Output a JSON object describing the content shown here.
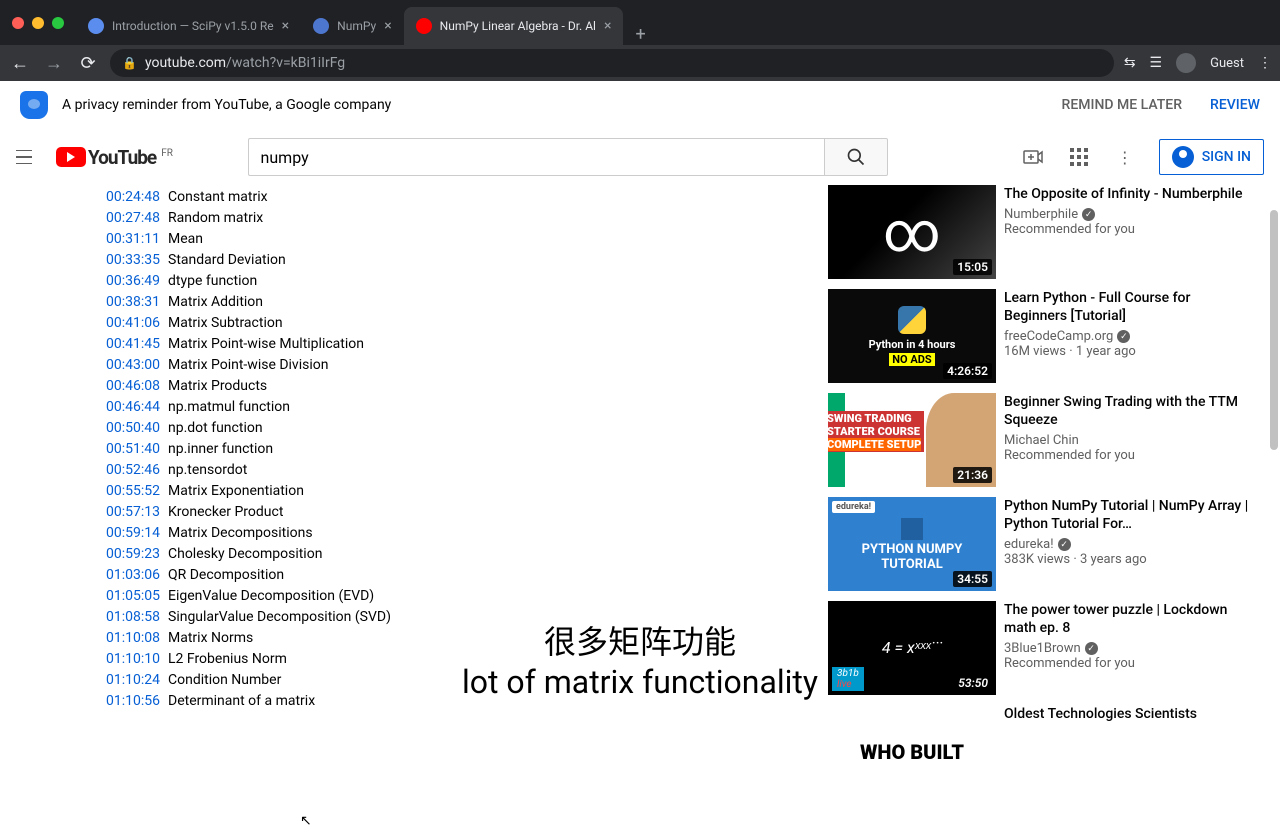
{
  "browser": {
    "tabs": [
      {
        "title": "Introduction — SciPy v1.5.0 Re"
      },
      {
        "title": "NumPy"
      },
      {
        "title": "NumPy Linear Algebra - Dr. Al"
      }
    ],
    "url_domain": "youtube.com",
    "url_path": "/watch?v=kBi1iIrFg",
    "guest_label": "Guest"
  },
  "privacy": {
    "text": "A privacy reminder from YouTube, a Google company",
    "remind": "REMIND ME LATER",
    "review": "REVIEW"
  },
  "yt_header": {
    "logo_text": "YouTube",
    "region": "FR",
    "search_value": "numpy",
    "signin": "SIGN IN"
  },
  "chapters": [
    {
      "time": "00:24:48",
      "label": "Constant matrix"
    },
    {
      "time": "00:27:48",
      "label": "Random matrix"
    },
    {
      "time": "00:31:11",
      "label": "Mean"
    },
    {
      "time": "00:33:35",
      "label": "Standard Deviation"
    },
    {
      "time": "00:36:49",
      "label": "dtype function"
    },
    {
      "time": "00:38:31",
      "label": "Matrix Addition"
    },
    {
      "time": "00:41:06",
      "label": "Matrix Subtraction"
    },
    {
      "time": "00:41:45",
      "label": "Matrix Point-wise Multiplication"
    },
    {
      "time": "00:43:00",
      "label": "Matrix Point-wise Division"
    },
    {
      "time": "00:46:08",
      "label": "Matrix Products"
    },
    {
      "time": "00:46:44",
      "label": "np.matmul function"
    },
    {
      "time": "00:50:40",
      "label": "np.dot function"
    },
    {
      "time": "00:51:40",
      "label": "np.inner function"
    },
    {
      "time": "00:52:46",
      "label": "np.tensordot"
    },
    {
      "time": "00:55:52",
      "label": "Matrix Exponentiation"
    },
    {
      "time": "00:57:13",
      "label": "Kronecker Product"
    },
    {
      "time": "00:59:14",
      "label": "Matrix Decompositions"
    },
    {
      "time": "00:59:23",
      "label": "Cholesky Decomposition"
    },
    {
      "time": "01:03:06",
      "label": "QR Decomposition"
    },
    {
      "time": "01:05:05",
      "label": "EigenValue Decomposition (EVD)"
    },
    {
      "time": "01:08:58",
      "label": "SingularValue Decomposition (SVD)"
    },
    {
      "time": "01:10:08",
      "label": "Matrix Norms"
    },
    {
      "time": "01:10:10",
      "label": "L2 Frobenius Norm"
    },
    {
      "time": "01:10:24",
      "label": "Condition Number"
    },
    {
      "time": "01:10:56",
      "label": "Determinant of a matrix"
    }
  ],
  "recommendations": [
    {
      "title": "The Opposite of Infinity - Numberphile",
      "channel": "Numberphile",
      "verified": true,
      "stats": "Recommended for you",
      "duration": "15:05"
    },
    {
      "title": "Learn Python - Full Course for Beginners [Tutorial]",
      "channel": "freeCodeCamp.org",
      "verified": true,
      "stats": "16M views · 1 year ago",
      "duration": "4:26:52",
      "thumb_text1": "Python in 4 hours",
      "thumb_text2": "NO ADS"
    },
    {
      "title": "Beginner Swing Trading with the TTM Squeeze",
      "channel": "Michael Chin",
      "verified": false,
      "stats": "Recommended for you",
      "duration": "21:36",
      "thumb_text1": "SWING TRADING",
      "thumb_text2": "STARTER COURSE"
    },
    {
      "title": "Python NumPy Tutorial | NumPy Array | Python Tutorial For…",
      "channel": "edureka!",
      "verified": true,
      "stats": "383K views · 3 years ago",
      "duration": "34:55",
      "thumb_text1": "PYTHON NUMPY",
      "thumb_text2": "TUTORIAL",
      "thumb_badge": "edureka!"
    },
    {
      "title": "The power tower puzzle | Lockdown math ep. 8",
      "channel": "3Blue1Brown",
      "verified": true,
      "stats": "Recommended for you",
      "duration": "53:50",
      "thumb_text1": "4 = xˣˣˣ˙˙˙",
      "thumb_badge": "3b1b"
    },
    {
      "title": "Oldest Technologies Scientists",
      "channel": "",
      "verified": false,
      "stats": "",
      "duration": "",
      "thumb_text1": "WHO BUILT"
    }
  ],
  "captions": {
    "cn": "很多矩阵功能",
    "en": "lot of matrix functionality"
  }
}
